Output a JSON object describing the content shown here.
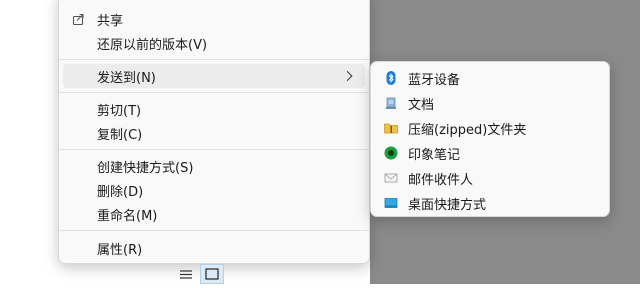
{
  "context_menu": {
    "items": [
      {
        "label": "共享",
        "icon": "share-icon"
      },
      {
        "label": "还原以前的版本(V)"
      },
      {
        "label": "发送到(N)",
        "has_submenu": true,
        "highlighted": true
      },
      {
        "label": "剪切(T)"
      },
      {
        "label": "复制(C)"
      },
      {
        "label": "创建快捷方式(S)"
      },
      {
        "label": "删除(D)"
      },
      {
        "label": "重命名(M)"
      },
      {
        "label": "属性(R)"
      }
    ]
  },
  "send_to_submenu": {
    "items": [
      {
        "label": "蓝牙设备",
        "icon": "bluetooth-icon"
      },
      {
        "label": "文档",
        "icon": "documents-icon"
      },
      {
        "label": "压缩(zipped)文件夹",
        "icon": "zip-folder-icon"
      },
      {
        "label": "印象笔记",
        "icon": "evernote-icon"
      },
      {
        "label": "邮件收件人",
        "icon": "mail-icon"
      },
      {
        "label": "桌面快捷方式",
        "icon": "desktop-icon"
      }
    ]
  },
  "view_buttons": [
    {
      "icon": "details-view-icon",
      "selected": false
    },
    {
      "icon": "tiles-view-icon",
      "selected": true
    }
  ],
  "colors": {
    "menu_background": "#f9f9f9",
    "hover_background": "#ececec",
    "right_backdrop": "#8a8a8a",
    "bluetooth_blue": "#1e7bd6"
  }
}
